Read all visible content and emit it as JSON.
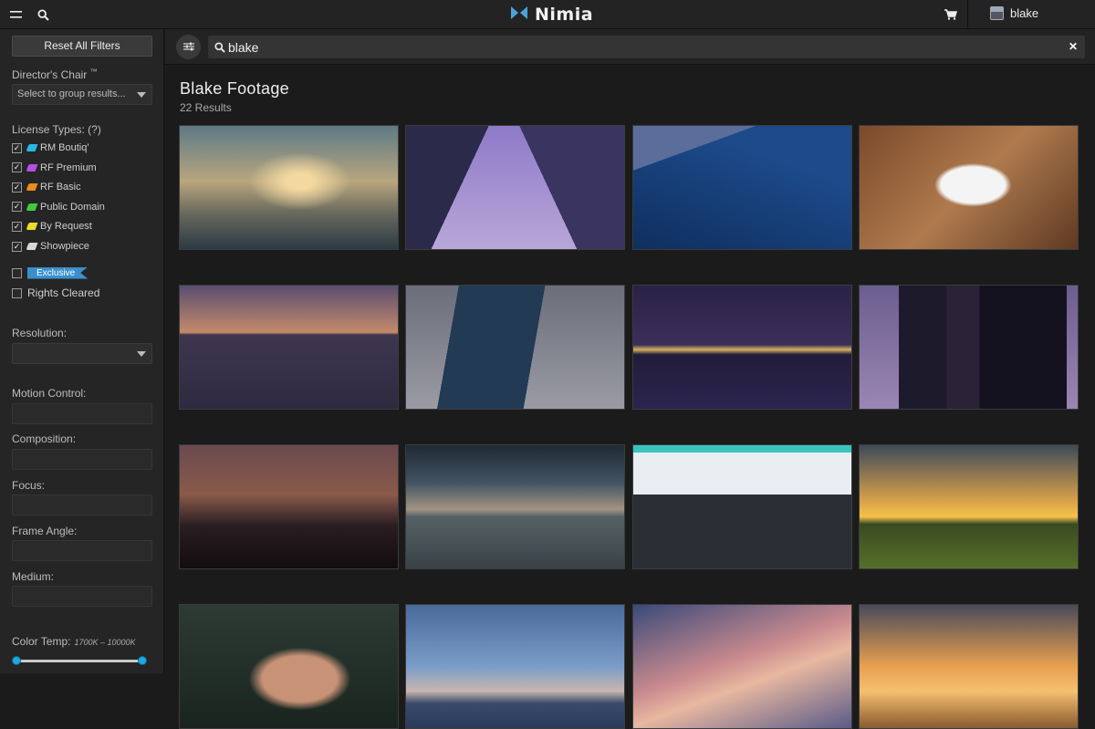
{
  "topbar": {
    "brand": "Nimia",
    "user_name": "blake",
    "icons": {
      "menu": "menu-icon",
      "search": "search-icon",
      "cart": "cart-icon",
      "logo": "nimia-logo-icon"
    }
  },
  "sidebar": {
    "reset_label": "Reset All Filters",
    "directors_chair_label": "Director's Chair",
    "directors_chair_tm": "™",
    "directors_chair_placeholder": "Select to group results...",
    "license_types_label": "License Types: (?)",
    "licenses": [
      {
        "label": "RM Boutiq'",
        "color": "#2bb6e8",
        "checked": true
      },
      {
        "label": "RF Premium",
        "color": "#b64ee8",
        "checked": true
      },
      {
        "label": "RF Basic",
        "color": "#f08a1c",
        "checked": true
      },
      {
        "label": "Public Domain",
        "color": "#3dcc3d",
        "checked": true
      },
      {
        "label": "By Request",
        "color": "#e8e028",
        "checked": true
      },
      {
        "label": "Showpiece",
        "color": "#d8d8d8",
        "checked": true
      }
    ],
    "exclusive_label": "Exclusive",
    "rights_cleared_label": "Rights Cleared",
    "resolution_label": "Resolution:",
    "motion_control_label": "Motion Control:",
    "composition_label": "Composition:",
    "focus_label": "Focus:",
    "frame_angle_label": "Frame Angle:",
    "medium_label": "Medium:",
    "color_temp_label": "Color Temp:",
    "color_temp_range": "1700K – 10000K",
    "color_temp_min_fraction": 0,
    "color_temp_max_fraction": 1,
    "accent_color": "#1ea7e0"
  },
  "search": {
    "query": "blake",
    "icons": {
      "filters": "sliders-icon",
      "search": "search-icon",
      "clear": "close-icon"
    }
  },
  "results": {
    "title": "Blake Footage",
    "count_label": "22 Results",
    "thumbnails": [
      {
        "subject": "cloudy-sunset-sky"
      },
      {
        "subject": "purple-skyscrapers-looking-up"
      },
      {
        "subject": "blue-glass-tower-looking-up"
      },
      {
        "subject": "white-dog-on-wood-floor"
      },
      {
        "subject": "bay-at-dusk-mountains"
      },
      {
        "subject": "glass-skyscraper-overcast"
      },
      {
        "subject": "city-skyline-night-water"
      },
      {
        "subject": "downtown-towers-twilight"
      },
      {
        "subject": "waterfront-night-ferris-wheel"
      },
      {
        "subject": "bay-overcast-dusk"
      },
      {
        "subject": "helicopter-cockpit-pilots"
      },
      {
        "subject": "farm-field-sunset-tree"
      },
      {
        "subject": "man-portrait-close-up"
      },
      {
        "subject": "city-skyline-blue-hour"
      },
      {
        "subject": "pink-clouds-sky"
      },
      {
        "subject": "golden-sunset-tree"
      }
    ]
  }
}
